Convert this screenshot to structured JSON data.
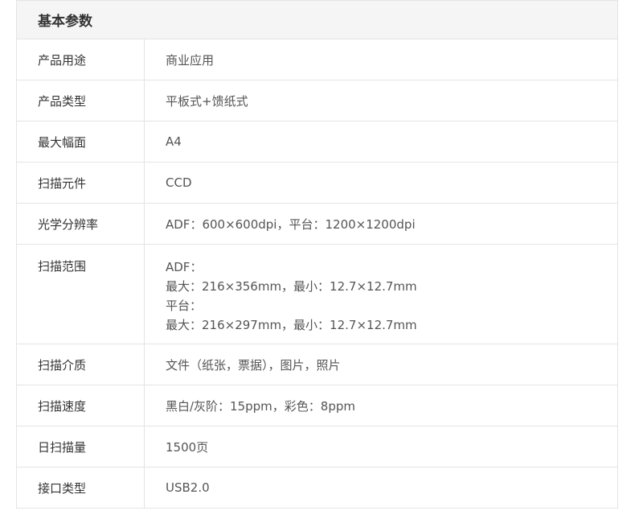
{
  "section_title": "基本参数",
  "rows": [
    {
      "label": "产品用途",
      "value": "商业应用"
    },
    {
      "label": "产品类型",
      "value": "平板式+馈纸式"
    },
    {
      "label": "最大幅面",
      "value": "A4"
    },
    {
      "label": "扫描元件",
      "value": "CCD"
    },
    {
      "label": "光学分辨率",
      "value": "ADF：600×600dpi，平台：1200×1200dpi"
    },
    {
      "label": "扫描范围",
      "lines": [
        "ADF：",
        "最大：216×356mm，最小：12.7×12.7mm",
        "平台：",
        "最大：216×297mm，最小：12.7×12.7mm"
      ]
    },
    {
      "label": "扫描介质",
      "value": "文件（纸张，票据），图片，照片"
    },
    {
      "label": "扫描速度",
      "value": "黑白/灰阶：15ppm，彩色：8ppm"
    },
    {
      "label": "日扫描量",
      "value": "1500页"
    },
    {
      "label": "接口类型",
      "value": "USB2.0"
    }
  ]
}
